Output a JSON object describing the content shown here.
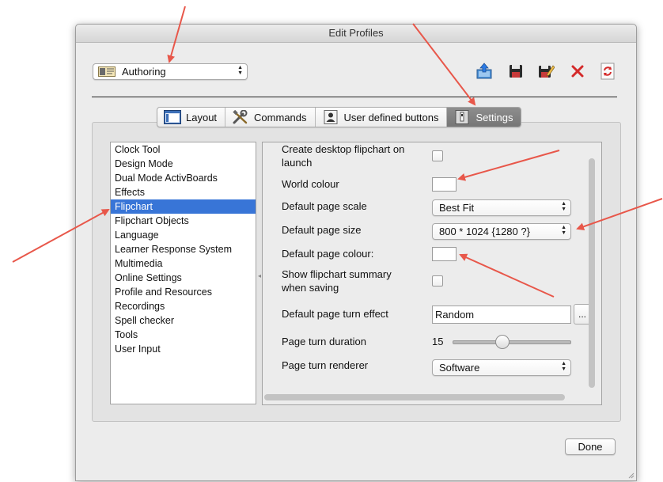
{
  "window": {
    "title": "Edit Profiles"
  },
  "profile_select": {
    "value": "Authoring"
  },
  "toolbar_icons": [
    "export-icon",
    "save-icon",
    "save-as-icon",
    "delete-icon",
    "refresh-icon"
  ],
  "tabs": [
    {
      "label": "Layout",
      "icon": "layout-icon",
      "active": false
    },
    {
      "label": "Commands",
      "icon": "tools-icon",
      "active": false
    },
    {
      "label": "User defined buttons",
      "icon": "user-button-icon",
      "active": false
    },
    {
      "label": "Settings",
      "icon": "settings-icon",
      "active": true
    }
  ],
  "categories": {
    "items": [
      "Clock Tool",
      "Design Mode",
      "Dual Mode ActivBoards",
      "Effects",
      "Flipchart",
      "Flipchart Objects",
      "Language",
      "Learner Response System",
      "Multimedia",
      "Online Settings",
      "Profile and Resources",
      "Recordings",
      "Spell checker",
      "Tools",
      "User Input"
    ],
    "selected": "Flipchart"
  },
  "settings": {
    "create_desktop_label_1": "Create desktop flipchart on",
    "create_desktop_label_2": "launch",
    "world_colour_label": "World colour",
    "default_page_scale_label": "Default page scale",
    "default_page_scale_value": "Best Fit",
    "default_page_size_label": "Default page size",
    "default_page_size_value": "800 * 1024 {1280 ?}",
    "default_page_colour_label": "Default page colour:",
    "show_summary_label_1": "Show flipchart summary",
    "show_summary_label_2": "when saving",
    "page_turn_effect_label": "Default page turn effect",
    "page_turn_effect_value": "Random",
    "page_turn_effect_button": "...",
    "page_turn_duration_label": "Page turn duration",
    "page_turn_duration_value": "15",
    "page_turn_duration_fraction": 0.42,
    "page_turn_renderer_label": "Page turn renderer",
    "page_turn_renderer_value": "Software"
  },
  "buttons": {
    "done": "Done"
  },
  "colors": {
    "selection": "#3875d7",
    "annotation_arrow": "#e8574a",
    "swatch_white": "#ffffff"
  }
}
